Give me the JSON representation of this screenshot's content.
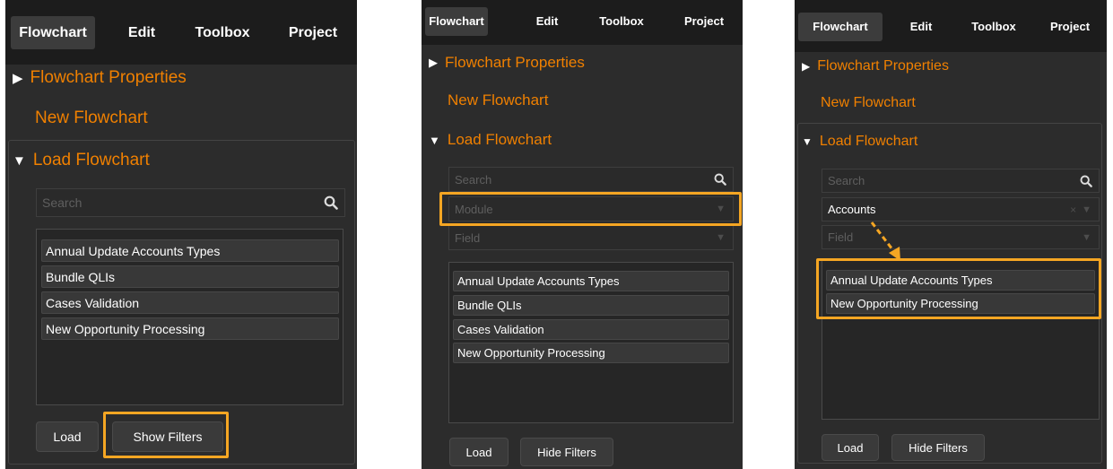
{
  "colors": {
    "panel_bg": "#2c2c2c",
    "accent": "#f08000",
    "highlight": "#f5a623",
    "text": "#ffffff"
  },
  "icons": {
    "collapsed": "▶",
    "expanded": "▼",
    "search": "search-icon",
    "dropdown": "▼",
    "clear": "×"
  },
  "panels": [
    {
      "tabs": [
        "Flowchart",
        "Edit",
        "Toolbox",
        "Project"
      ],
      "active_tab": "Flowchart",
      "flowchart_properties": "Flowchart Properties",
      "new_flowchart": "New Flowchart",
      "load_flowchart": "Load Flowchart",
      "search_placeholder": "Search",
      "items": [
        "Annual Update Accounts Types",
        "Bundle QLIs",
        "Cases Validation",
        "New Opportunity Processing"
      ],
      "load_button": "Load",
      "filter_button": "Show Filters"
    },
    {
      "tabs": [
        "Flowchart",
        "Edit",
        "Toolbox",
        "Project"
      ],
      "active_tab": "Flowchart",
      "flowchart_properties": "Flowchart Properties",
      "new_flowchart": "New Flowchart",
      "load_flowchart": "Load Flowchart",
      "search_placeholder": "Search",
      "module_placeholder": "Module",
      "field_placeholder": "Field",
      "items": [
        "Annual Update Accounts Types",
        "Bundle QLIs",
        "Cases Validation",
        "New Opportunity Processing"
      ],
      "load_button": "Load",
      "filter_button": "Hide Filters"
    },
    {
      "tabs": [
        "Flowchart",
        "Edit",
        "Toolbox",
        "Project"
      ],
      "active_tab": "Flowchart",
      "flowchart_properties": "Flowchart Properties",
      "new_flowchart": "New Flowchart",
      "load_flowchart": "Load Flowchart",
      "search_placeholder": "Search",
      "module_value": "Accounts",
      "field_placeholder": "Field",
      "items": [
        "Annual Update Accounts Types",
        "New Opportunity Processing"
      ],
      "load_button": "Load",
      "filter_button": "Hide Filters"
    }
  ]
}
